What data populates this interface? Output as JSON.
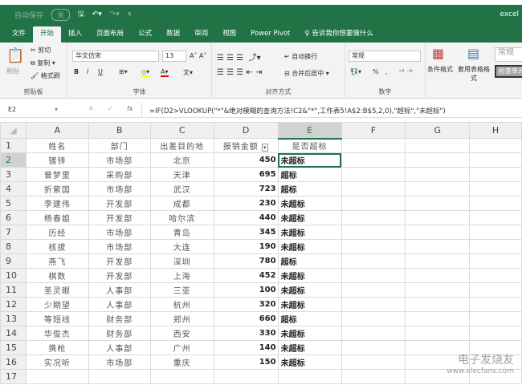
{
  "titlebar": {
    "autosave": "自动保存",
    "autosave_state": "关",
    "filename": "excel"
  },
  "tabs": [
    "文件",
    "开始",
    "插入",
    "页面布局",
    "公式",
    "数据",
    "审阅",
    "视图",
    "Power Pivot"
  ],
  "tell_me": "告诉我你想要做什么",
  "ribbon": {
    "clipboard": {
      "paste": "粘贴",
      "cut": "剪切",
      "copy": "复制",
      "format_painter": "格式刷",
      "label": "剪贴板"
    },
    "font": {
      "name": "华文仿宋",
      "size": "13",
      "label": "字体",
      "bold": "B",
      "italic": "I",
      "underline": "U"
    },
    "alignment": {
      "wrap": "自动换行",
      "merge": "合并后居中",
      "label": "对齐方式"
    },
    "number": {
      "format": "常规",
      "percent": "%",
      "comma": ",",
      "label": "数字"
    },
    "styles": {
      "conditional": "条件格式",
      "table": "套用表格格式",
      "normal": "常规",
      "check": "检查单元"
    }
  },
  "formula_bar": {
    "name_box": "E2",
    "fx": "fx",
    "formula": "=IF(D2>VLOOKUP(\"*\"&绝对模糊的查询方法!C2&\"*\",工作表5!A$2:B$5,2,0),\"超标\",\"未超标\")"
  },
  "columns": [
    "A",
    "B",
    "C",
    "D",
    "E",
    "F",
    "G",
    "H"
  ],
  "headers": [
    "姓名",
    "部门",
    "出差目的地",
    "报销金额",
    "是否超标"
  ],
  "rows": [
    [
      "镀锌",
      "市场部",
      "北京",
      "450",
      "未超标"
    ],
    [
      "曾梦里",
      "采购部",
      "天津",
      "695",
      "超标"
    ],
    [
      "折紫国",
      "市场部",
      "武汉",
      "723",
      "超标"
    ],
    [
      "李建伟",
      "开发部",
      "成都",
      "230",
      "未超标"
    ],
    [
      "杨春姐",
      "开发部",
      "哈尔滨",
      "440",
      "未超标"
    ],
    [
      "历经",
      "市场部",
      "青岛",
      "345",
      "未超标"
    ],
    [
      "核拔",
      "市场部",
      "大连",
      "190",
      "未超标"
    ],
    [
      "燕飞",
      "开发部",
      "深圳",
      "780",
      "超标"
    ],
    [
      "棋数",
      "开发部",
      "上海",
      "452",
      "未超标"
    ],
    [
      "圣灵眼",
      "人事部",
      "三亚",
      "100",
      "未超标"
    ],
    [
      "少期望",
      "人事部",
      "杭州",
      "320",
      "未超标"
    ],
    [
      "等短线",
      "财务部",
      "郑州",
      "660",
      "超标"
    ],
    [
      "华俊杰",
      "财务部",
      "西安",
      "330",
      "未超标"
    ],
    [
      "携枪",
      "人事部",
      "广州",
      "140",
      "未超标"
    ],
    [
      "实况听",
      "市场部",
      "重庆",
      "150",
      "未超标"
    ]
  ],
  "row_numbers": [
    "1",
    "2",
    "3",
    "4",
    "5",
    "6",
    "7",
    "8",
    "9",
    "10",
    "11",
    "12",
    "13",
    "14",
    "15",
    "16",
    "17"
  ],
  "watermark": {
    "name": "电子发烧友",
    "url": "www.elecfans.com"
  }
}
